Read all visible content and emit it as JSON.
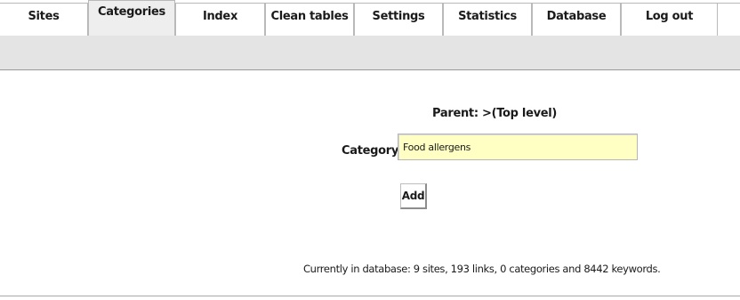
{
  "nav": {
    "tabs": [
      {
        "label": "Sites",
        "active": false
      },
      {
        "label": "Categories",
        "active": true
      },
      {
        "label": "Index",
        "active": false
      },
      {
        "label": "Clean tables",
        "active": false
      },
      {
        "label": "Settings",
        "active": false
      },
      {
        "label": "Statistics",
        "active": false
      },
      {
        "label": "Database",
        "active": false
      },
      {
        "label": "Log out",
        "active": false
      }
    ]
  },
  "form": {
    "parent_text": "Parent: >(Top level)",
    "category_label": "Category:",
    "category_value": "Food allergens",
    "add_button_label": "Add"
  },
  "status": {
    "text": "Currently in database: 9 sites, 193 links, 0 categories and 8442 keywords."
  },
  "colors": {
    "input_background": "#ffffc4",
    "active_tab_background": "#eeeeee",
    "strip_background": "#e4e4e4"
  }
}
